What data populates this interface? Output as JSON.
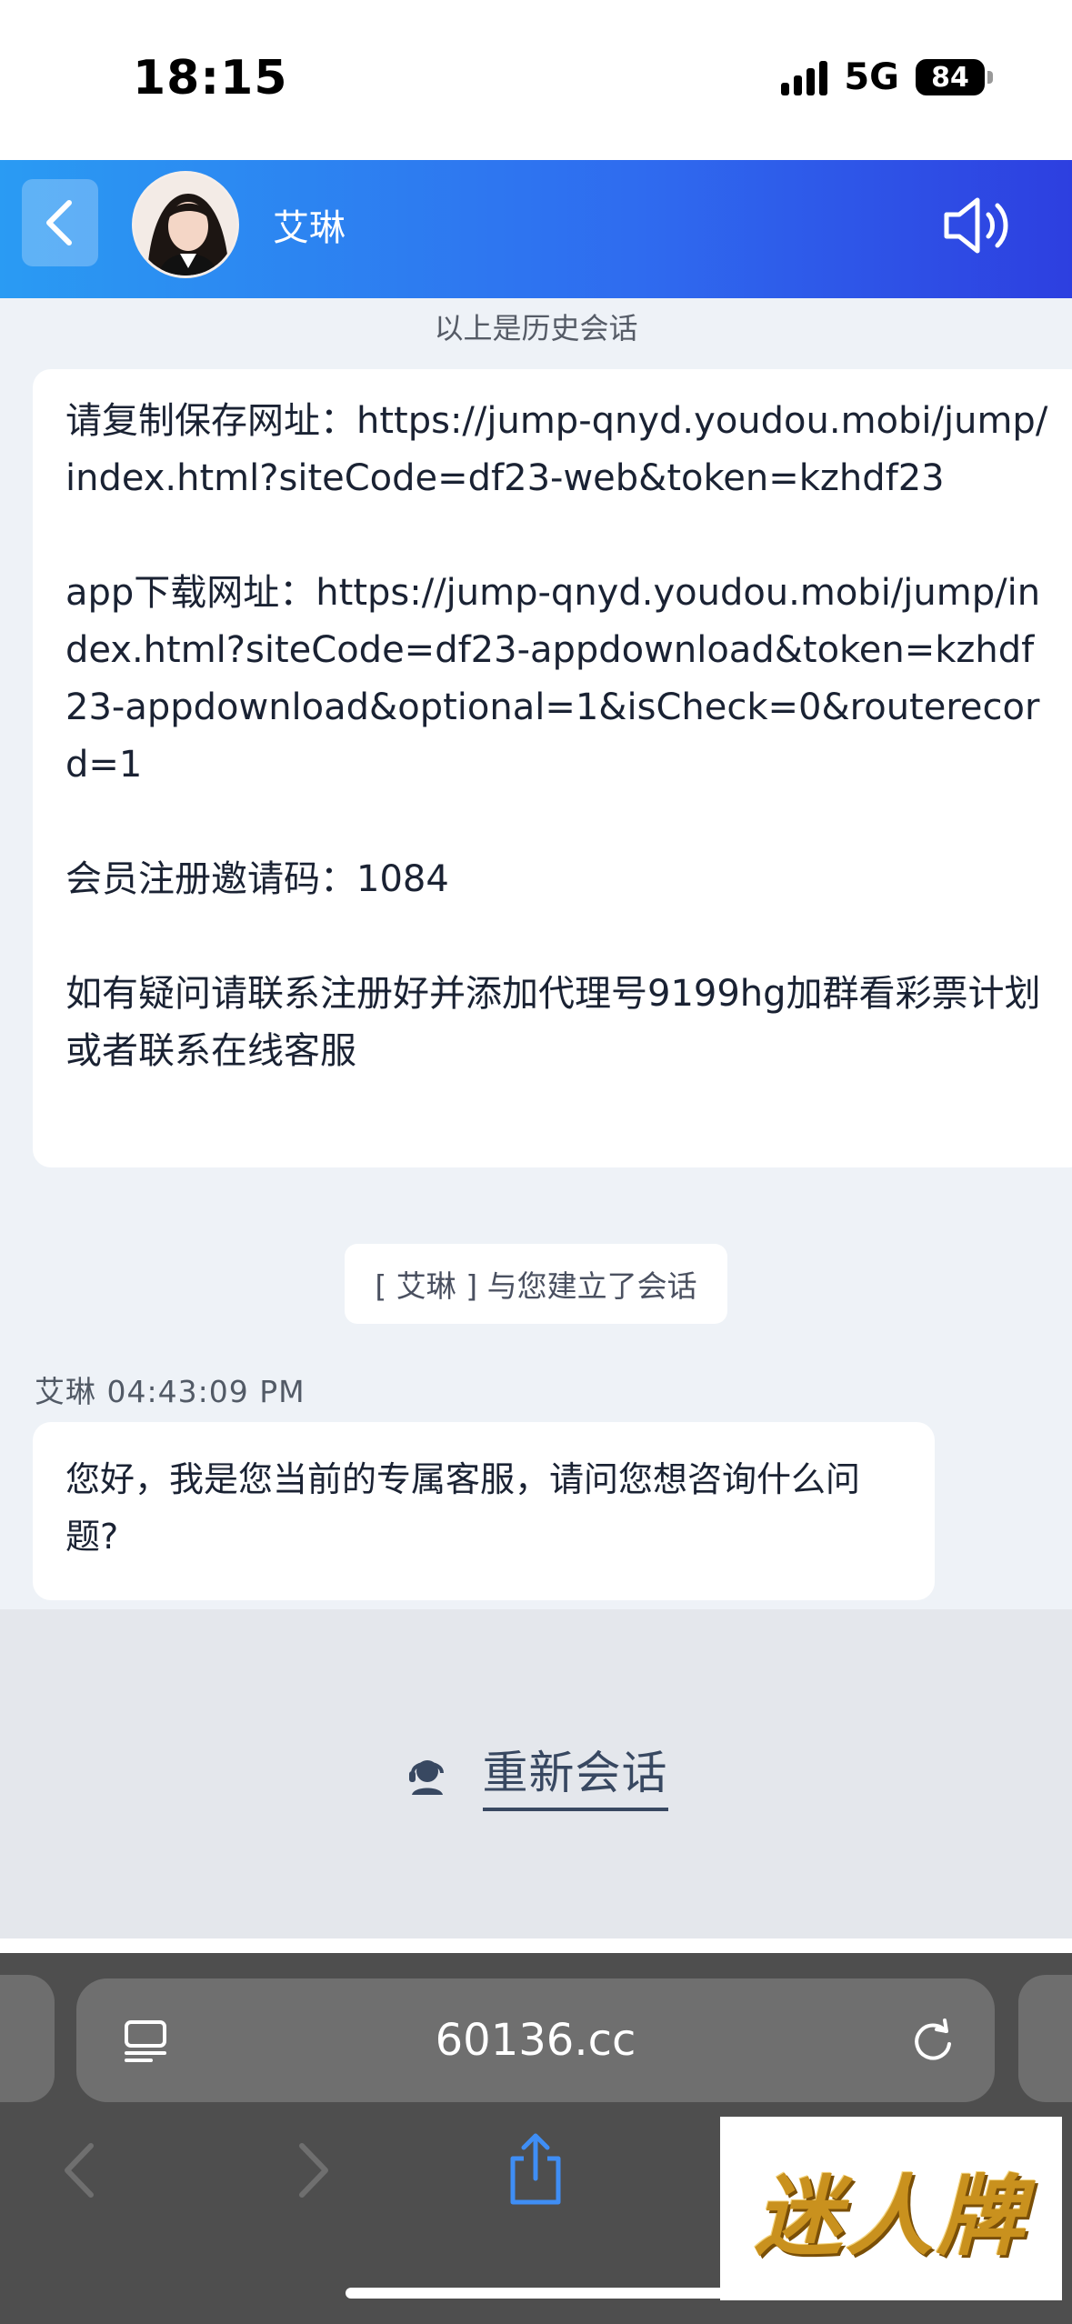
{
  "status_bar": {
    "time": "18:15",
    "network": "5G",
    "battery": "84"
  },
  "header": {
    "agent_name": "艾琳"
  },
  "chat": {
    "history_note": "以上是历史会话",
    "history_message": "请复制保存网址：https://jump-qnyd.youdou.mobi/jump/index.html?siteCode=df23-web&token=kzhdf23\n\napp下载网址：https://jump-qnyd.youdou.mobi/jump/index.html?siteCode=df23-appdownload&token=kzhdf23-appdownload&optional=1&isCheck=0&routerecord=1\n\n会员注册邀请码：1084\n\n如有疑问请联系注册好并添加代理号9199hg加群看彩票计划或者联系在线客服",
    "system_notice": "[ 艾琳 ] 与您建立了会话",
    "message_meta": "艾琳 04:43:09 PM",
    "message_text": "您好，我是您当前的专属客服，请问您想咨询什么问题?"
  },
  "restart": {
    "label": "重新会话"
  },
  "browser": {
    "url": "60136.cc"
  },
  "ad": {
    "logo_text": "迷人牌"
  }
}
